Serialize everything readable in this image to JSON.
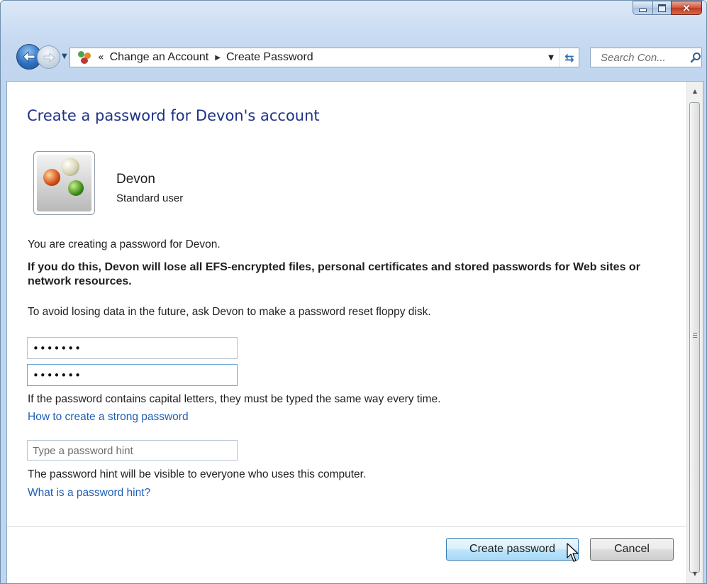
{
  "window": {
    "controls": {
      "minimize": "minimize",
      "maximize": "maximize",
      "close": "×"
    }
  },
  "address_bar": {
    "overflow": "«",
    "breadcrumbs": [
      "Change an Account",
      "Create Password"
    ]
  },
  "search": {
    "placeholder": "Search Con..."
  },
  "main": {
    "heading": "Create a password for Devon's account",
    "user": {
      "name": "Devon",
      "role": "Standard user"
    },
    "intro": "You are creating a password for Devon.",
    "warning": "If you do this, Devon will lose all EFS-encrypted files, personal certificates and stored passwords for Web sites or network resources.",
    "advice": "To avoid losing data in the future, ask Devon to make a password reset floppy disk.",
    "new_password": "•••••••",
    "confirm_password": "•••••••",
    "capital_note": "If the password contains capital letters, they must be typed the same way every time.",
    "strong_password_link": "How to create a strong password",
    "hint_placeholder": "Type a password hint",
    "hint_note": "The password hint will be visible to everyone who uses this computer.",
    "hint_link": "What is a password hint?",
    "create_button": "Create password",
    "cancel_button": "Cancel"
  },
  "colors": {
    "heading": "#1e3287",
    "link": "#1f5fb4",
    "frame": "#c5d9f1",
    "close_button": "#c13a1f"
  },
  "icons": [
    "back-arrow-icon",
    "forward-arrow-icon",
    "user-accounts-icon",
    "refresh-icon",
    "search-icon",
    "user-picture-marbles",
    "mouse-cursor-icon"
  ]
}
